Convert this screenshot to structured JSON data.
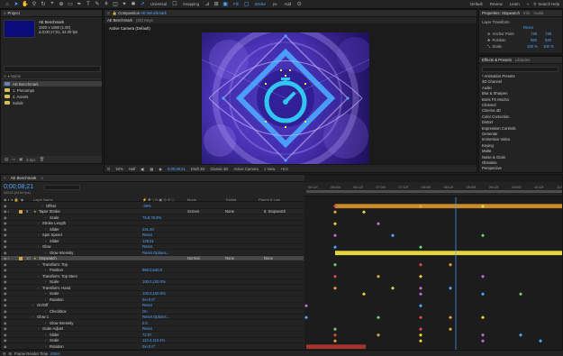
{
  "toolbar": {
    "universal": "Universal",
    "snapping": "Snapping",
    "fill": "Fill",
    "stroke": "Stroke",
    "stroke_width": "px",
    "add": "Add",
    "workspace_default": "Default",
    "workspace_review": "Review",
    "workspace_learn": "Learn",
    "search_help": "Search Help"
  },
  "project": {
    "tab": "Project",
    "selected_name": "AE Benchmark",
    "selected_dims": "1920 x 1080 (1.00)",
    "selected_duration": "Δ 0;00;17;01, 24.00 fps",
    "items": [
      {
        "name": "AE Benchmark",
        "type": "comp",
        "selected": true
      },
      {
        "name": "1. Precomps",
        "type": "folder"
      },
      {
        "name": "2. Assets",
        "type": "folder"
      },
      {
        "name": "Solids",
        "type": "folder"
      }
    ],
    "bpc": "8 bpc"
  },
  "composition": {
    "tab_prefix": "Composition",
    "tab_name": "AE Benchmark",
    "crumb_active": "AE Benchmark",
    "crumb_other": "(3D) Keys",
    "camera": "Active Camera (Default)",
    "zoom": "50%",
    "resolution": "Half",
    "timecode": "0;00;08;21",
    "renderer": "Draft 3D",
    "renderer_mode": "Classic 3D",
    "view": "Active Camera",
    "views": "1 View",
    "offset": "+0.0"
  },
  "properties": {
    "tab": "Properties: Stopwatch",
    "tab_info": "Info",
    "tab_audio": "Audio",
    "section": "Layer Transform",
    "reset": "Reset",
    "rows": [
      {
        "label": "Anchor Point",
        "v1": "738",
        "v2": "738"
      },
      {
        "label": "Position",
        "v1": "960",
        "v2": "540"
      },
      {
        "label": "Scale",
        "v1": "100 %",
        "v2": "100 %"
      }
    ],
    "preview_tab": "Preview"
  },
  "effects": {
    "tab": "Effects & Presets",
    "tab_libraries": "Libraries",
    "items": [
      "* Animation Presets",
      "3D Channel",
      "Audio",
      "Blur & Sharpen",
      "Boris FX Mocha",
      "Channel",
      "Cinema 4D",
      "Color Correction",
      "Distort",
      "Expression Controls",
      "Generate",
      "Immersive Video",
      "Keying",
      "Matte",
      "Noise & Grain",
      "Obsolete",
      "Perspective"
    ]
  },
  "timeline": {
    "tab": "AE Benchmark",
    "current_time": "0;00;08;21",
    "fps_note": "00213 (24.00 fps)",
    "col_layer": "Layer Name",
    "col_mode": "Mode",
    "col_trkmat": "TrkMat",
    "col_parent": "Parent & Link",
    "ruler_ticks": [
      "00:12f",
      "06:00f",
      "06:12f",
      "07:00f",
      "07:12f",
      "08:00f",
      "08:12f",
      "09:00f",
      "09:12f",
      "10:00f",
      "10:12f",
      "11:00f"
    ],
    "rows": [
      {
        "kind": "prop",
        "indent": 14,
        "name": "Offset",
        "value": "-36%"
      },
      {
        "kind": "layer",
        "num": "9",
        "name": "Taper Stroke",
        "label_color": "#d9a441",
        "value": "",
        "mode": "Screen",
        "trkmat": "None",
        "parent": "6. Stopwatch"
      },
      {
        "kind": "prop",
        "indent": 18,
        "name": "Scale",
        "value": "78.8,78.8%"
      },
      {
        "kind": "prop",
        "indent": 10,
        "name": "Stroke Length",
        "value": ""
      },
      {
        "kind": "prop",
        "indent": 18,
        "name": "Slider",
        "value": "241.40"
      },
      {
        "kind": "prop",
        "indent": 10,
        "name": "Spin Speed",
        "value": "Reset"
      },
      {
        "kind": "prop",
        "indent": 18,
        "name": "Slider",
        "value": "128.51"
      },
      {
        "kind": "prop",
        "indent": 10,
        "name": "Glow",
        "value": "Reset"
      },
      {
        "kind": "prop",
        "indent": 18,
        "name": "Glow Intensity",
        "value": "Reset Options..."
      },
      {
        "kind": "layer",
        "num": "10",
        "name": "Stopwatch",
        "label_color": "#d9a441",
        "value": "",
        "mode": "Normal",
        "trkmat": "None",
        "parent": "None",
        "highlight": true
      },
      {
        "kind": "prop",
        "indent": 10,
        "name": "Transform: Top",
        "value": ""
      },
      {
        "kind": "prop",
        "indent": 18,
        "name": "Position",
        "value": "960.0,540.0"
      },
      {
        "kind": "prop",
        "indent": 10,
        "name": "Transform: Top Stem",
        "value": ""
      },
      {
        "kind": "prop",
        "indent": 18,
        "name": "Scale",
        "value": "100.0,100.0%"
      },
      {
        "kind": "prop",
        "indent": 10,
        "name": "Transform: Hand",
        "value": ""
      },
      {
        "kind": "prop",
        "indent": 18,
        "name": "Scale",
        "value": "100.0,100.0%"
      },
      {
        "kind": "prop",
        "indent": 18,
        "name": "Rotation",
        "value": "0x+0.0°"
      },
      {
        "kind": "prop",
        "indent": 4,
        "name": "On/Off",
        "value": "Reset"
      },
      {
        "kind": "prop",
        "indent": 18,
        "name": "Checkbox",
        "value": "On"
      },
      {
        "kind": "prop",
        "indent": 4,
        "name": "Glow 1",
        "value": "Reset Options..."
      },
      {
        "kind": "prop",
        "indent": 18,
        "name": "Glow Intensity",
        "value": "0.0"
      },
      {
        "kind": "prop",
        "indent": 10,
        "name": "Scale Adjust",
        "value": "Reset"
      },
      {
        "kind": "prop",
        "indent": 18,
        "name": "Slider",
        "value": "72.97"
      },
      {
        "kind": "prop",
        "indent": 18,
        "name": "Scale",
        "value": "113.4,113.4%"
      },
      {
        "kind": "prop",
        "indent": 18,
        "name": "Rotation",
        "value": "0x+0.0°"
      },
      {
        "kind": "layer",
        "num": "11",
        "name": "wotate!",
        "label_color": "#c0392b",
        "value": "",
        "mode": "Normal",
        "trkmat": "None",
        "parent": "10. Wotate"
      }
    ],
    "footer_label": "Frame Render Time",
    "footer_ms": "83ms"
  },
  "colors": {
    "accent": "#4ea6ff",
    "playhead": "#4ea6ff",
    "yellow_bar": "#e6d63c",
    "orange_bar": "#c98a2a",
    "red_bar": "#a8332b"
  }
}
